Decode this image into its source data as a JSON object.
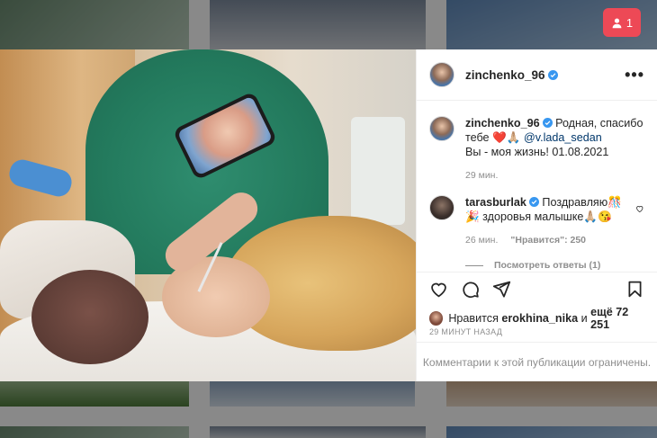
{
  "notification": {
    "count": "1",
    "color": "#ed4956",
    "icon": "person-icon"
  },
  "post": {
    "author": "zinchenko_96",
    "menu_glyph": "•••",
    "caption_text": "Родная, спасибо тебе",
    "caption_emoji": "❤️🙏🏼",
    "caption_mention": "@v.lada_sedan",
    "caption_line2": "Вы - моя жизнь! 01.08.2021",
    "caption_time": "29 мин.",
    "comments": [
      {
        "author": "tarasburlak",
        "text": "Поздравляю🎊🎉 здоровья малышке🙏🏼😘",
        "time": "26 мин.",
        "likes": "\"Нравится\": 250",
        "replies_label": "Посмотреть ответы (1)"
      }
    ],
    "liked_by_prefix": "Нравится",
    "liked_by_user": "erokhina_nika",
    "liked_by_connector": "и",
    "liked_by_rest": "ещё 72 251",
    "timestamp": "29 МИНУТ НАЗАД",
    "comments_restricted": "Комментарии к этой публикации ограничены."
  },
  "colors": {
    "verified": "#3897f0",
    "mention": "#00376b",
    "muted": "#8e8e8e"
  }
}
